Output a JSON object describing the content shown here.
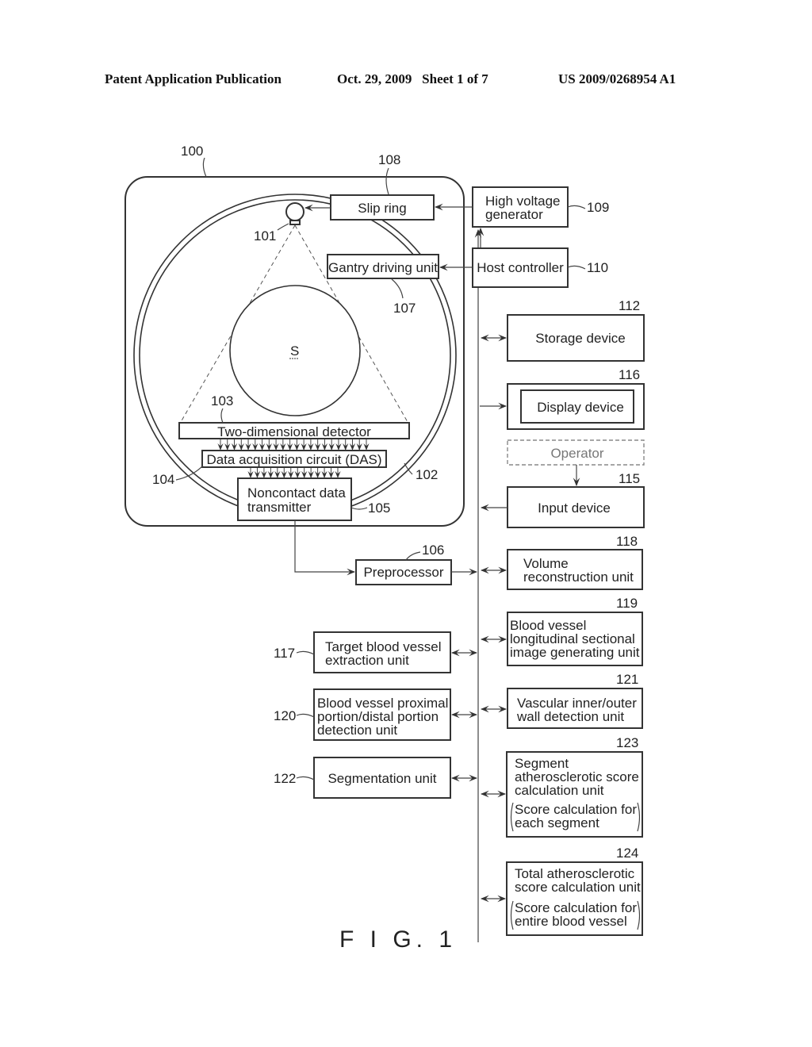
{
  "header": {
    "publication": "Patent Application Publication",
    "date_sheet": "Oct. 29, 2009   Sheet 1 of 7",
    "number": "US 2009/0268954 A1"
  },
  "figure_label": "F I G. 1",
  "gantry": {
    "ref": "100",
    "xray_tube_ref": "101",
    "ring_ref": "102",
    "subject_label": "S",
    "detector": {
      "ref": "103",
      "label": "Two-dimensional detector"
    },
    "das": {
      "ref": "104",
      "label": "Data acquisition circuit (DAS)"
    },
    "transmitter": {
      "ref": "105",
      "lines": [
        "Noncontact data",
        "transmitter"
      ]
    },
    "gantry_driving": {
      "ref": "107",
      "label": "Gantry driving unit"
    },
    "slip_ring": {
      "ref": "108",
      "label": "Slip ring"
    }
  },
  "blocks": {
    "high_voltage": {
      "ref": "109",
      "lines": [
        "High voltage",
        "generator"
      ]
    },
    "host_controller": {
      "ref": "110",
      "label": "Host controller"
    },
    "preprocessor": {
      "ref": "106",
      "label": "Preprocessor"
    },
    "storage": {
      "ref": "112",
      "label": "Storage device"
    },
    "display": {
      "ref": "116",
      "label": "Display device"
    },
    "operator": {
      "label": "Operator"
    },
    "input": {
      "ref": "115",
      "label": "Input device"
    },
    "volume": {
      "ref": "118",
      "lines": [
        "Volume",
        "reconstruction unit"
      ]
    },
    "longitudinal": {
      "ref": "119",
      "lines": [
        "Blood vessel",
        "longitudinal sectional",
        "image generating  unit"
      ]
    },
    "target": {
      "ref": "117",
      "lines": [
        "Target blood vessel",
        "extraction unit"
      ]
    },
    "proximal": {
      "ref": "120",
      "lines": [
        "Blood vessel proximal",
        "portion/distal portion",
        "detection unit"
      ]
    },
    "wall": {
      "ref": "121",
      "lines": [
        "Vascular inner/outer",
        "wall detection unit"
      ]
    },
    "segmentation": {
      "ref": "122",
      "label": "Segmentation unit"
    },
    "segment_score": {
      "ref": "123",
      "lines": [
        "Segment",
        "atherosclerotic score",
        "calculation unit",
        "Score calculation for",
        "each segment"
      ]
    },
    "total_score": {
      "ref": "124",
      "lines": [
        "Total atherosclerotic",
        "score calculation unit",
        "Score calculation for",
        "entire blood vessel"
      ]
    }
  }
}
